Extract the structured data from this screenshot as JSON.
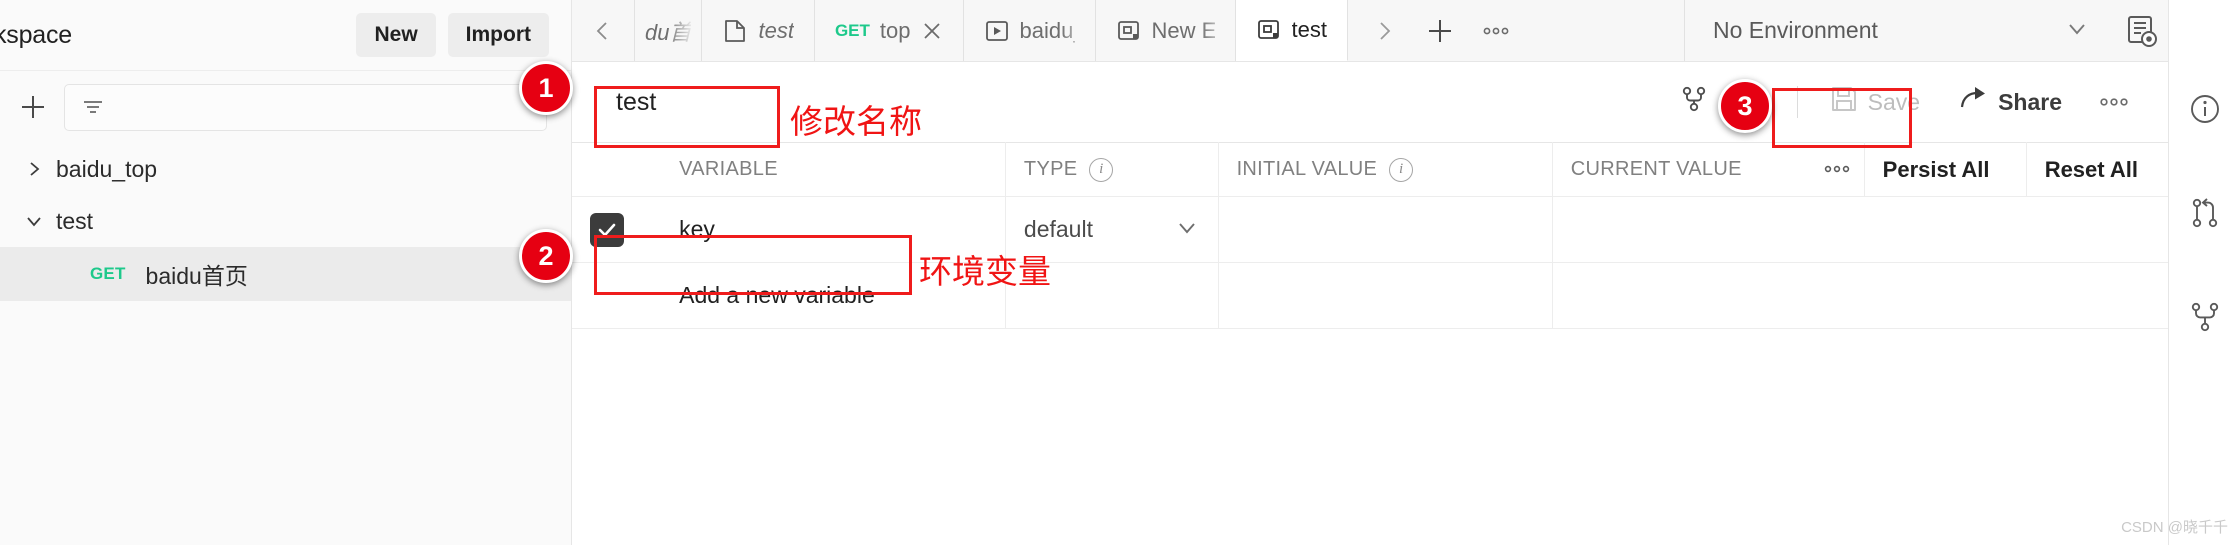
{
  "sidebar": {
    "title": "kspace",
    "new_label": "New",
    "import_label": "Import",
    "filter_placeholder": "",
    "add_icon": "plus-icon",
    "filter_icon": "filter-icon",
    "tree": [
      {
        "label": "baidu_top",
        "expanded": false,
        "chevron": "chevron-right-icon"
      },
      {
        "label": "test",
        "expanded": true,
        "chevron": "chevron-down-icon"
      }
    ],
    "request": {
      "method": "GET",
      "label": "baidu首页",
      "selected": true
    }
  },
  "tabbar": {
    "prev_icon": "chevron-left-icon",
    "next_icon": "chevron-right-icon",
    "add_icon": "plus-icon",
    "more_icon": "ellipsis-icon",
    "tabs": [
      {
        "label": "du首",
        "icon": "document-icon",
        "method": "",
        "italic": true,
        "active": false,
        "closable": false
      },
      {
        "label": "test",
        "icon": "document-icon",
        "method": "",
        "italic": true,
        "active": false,
        "closable": false
      },
      {
        "label": "top",
        "icon": "",
        "method": "GET",
        "italic": false,
        "active": false,
        "closable": true
      },
      {
        "label": "baidu_t",
        "icon": "runner-icon",
        "method": "",
        "italic": false,
        "active": false,
        "closable": false
      },
      {
        "label": "New En",
        "icon": "environment-icon",
        "method": "",
        "italic": false,
        "active": false,
        "closable": false
      },
      {
        "label": "test",
        "icon": "environment-icon",
        "method": "",
        "italic": false,
        "active": true,
        "closable": false
      }
    ],
    "environment": {
      "selected": "No Environment",
      "chevron": "chevron-down-icon",
      "eye_icon": "environment-quick-look-icon"
    }
  },
  "editor": {
    "name_value": "test",
    "actions": {
      "fork": "Fork",
      "fork_icon": "fork-icon",
      "save": "Save",
      "save_icon": "floppy-disk-icon",
      "save_disabled": true,
      "share": "Share",
      "share_icon": "share-arrow-icon",
      "more_icon": "ellipsis-icon"
    }
  },
  "table": {
    "headers": {
      "variable": "VARIABLE",
      "type": "TYPE",
      "initial_value": "INITIAL VALUE",
      "current_value": "CURRENT VALUE",
      "persist_all": "Persist All",
      "reset_all": "Reset All",
      "more_icon": "ellipsis-icon",
      "type_info_icon": "info-icon",
      "initial_info_icon": "info-icon"
    },
    "rows": [
      {
        "checked": true,
        "variable": "key",
        "type": "default",
        "type_chevron": "chevron-down-icon",
        "initial_value": "",
        "current_value": ""
      }
    ],
    "new_row_placeholder": "Add a new variable"
  },
  "rail": {
    "items": [
      {
        "icon": "info-circle-icon",
        "name": "info"
      },
      {
        "icon": "pull-request-icon",
        "name": "pull-requests"
      },
      {
        "icon": "fork-icon",
        "name": "forks"
      }
    ]
  },
  "annotations": {
    "badge1": "1",
    "badge2": "2",
    "badge3": "3",
    "note_name": "修改名称",
    "note_env_var": "环境变量"
  },
  "watermark": "CSDN @晓千千"
}
